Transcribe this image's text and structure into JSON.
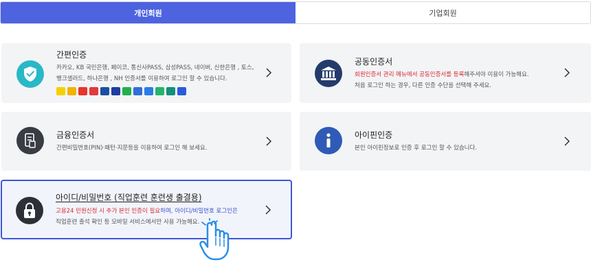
{
  "tabs": {
    "personal": "개인회원",
    "business": "기업회원"
  },
  "cards": {
    "simple": {
      "title": "간편인증",
      "desc_line1": "카카오, KB 국민은행, 페이코, 통신사PASS, 삼성PASS, 네이버, 신한은행 , 토스,",
      "desc_line2": "뱅크샐러드, 하나은행 , NH 인증서를 이용하여 로그인 할 수 있습니다.",
      "logos": [
        {
          "name": "kakao-logo",
          "color": "#f5d000"
        },
        {
          "name": "kb-logo",
          "color": "#f0b400"
        },
        {
          "name": "payco-logo",
          "color": "#e8352c"
        },
        {
          "name": "pass-logo",
          "color": "#e03a3a"
        },
        {
          "name": "samsung-pass-logo",
          "color": "#1c4fa0"
        },
        {
          "name": "pass-blue-logo",
          "color": "#1d3f9e"
        },
        {
          "name": "naver-logo",
          "color": "#21b14a"
        },
        {
          "name": "shinhan-logo",
          "color": "#2f6fd6"
        },
        {
          "name": "toss-logo",
          "color": "#2a7de8"
        },
        {
          "name": "banksalad-logo",
          "color": "#25b46e"
        },
        {
          "name": "hana-logo",
          "color": "#12907a"
        },
        {
          "name": "nh-logo",
          "color": "#2c5bd8"
        }
      ]
    },
    "joint": {
      "title": "공동인증서",
      "desc_red": "회원인증서 관리 메뉴에서 공동인증서를 등록",
      "desc_rest": "해주셔야 이용이 가능해요.",
      "desc_line2": "처음 로그인 하는 경우, 다른 인증 수단을 선택해 주세요."
    },
    "finance": {
      "title": "금융인증서",
      "desc_line1": "간편비밀번호(PIN)·패턴·지문등을 이용하여 로그인 해 보세요."
    },
    "ipin": {
      "title": "아이핀인증",
      "desc_line1": "본인 아이핀정보로 인증 후 로그인 할 수 있습니다."
    },
    "idpw": {
      "title": "아이디/비밀번호 (직업훈련 훈련생 출결용)",
      "desc_red": "고용24 민원신청 시 추가 본인 인증이 필요",
      "desc_rest": "하며, 아이디/비밀번호 로그인은",
      "desc_line2": "직업훈련 출석 확인 등 모바일 서비스에서만 사용 가능해요."
    }
  },
  "colors": {
    "accent": "#4d63e0",
    "red": "#d9282e",
    "shield_teal": "#29b8c6",
    "dark_icon": "#3a3c44",
    "bank_navy": "#243b6b",
    "ipin_blue": "#2f5bb7"
  }
}
